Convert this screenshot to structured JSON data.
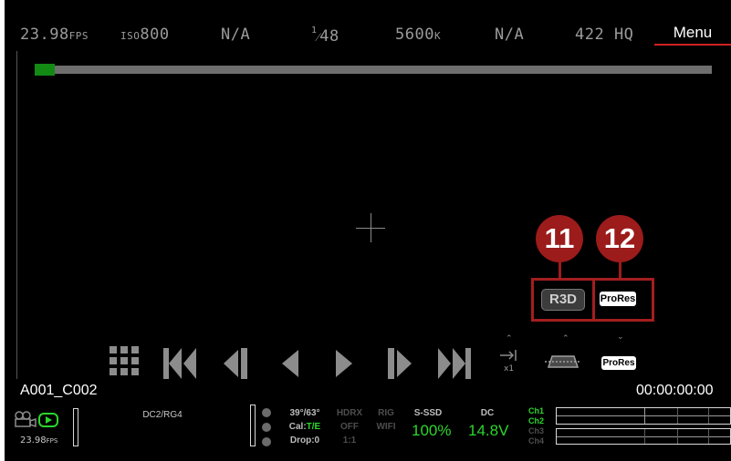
{
  "top_bar": {
    "fps": "23.98",
    "fps_unit": "FPS",
    "iso_prefix": "ISO",
    "iso_value": "800",
    "field3": "N/A",
    "shutter_num": "1",
    "shutter_den": "48",
    "white_balance": "5600",
    "wb_unit": "K",
    "field6": "N/A",
    "codec": "422 HQ",
    "menu_label": "Menu"
  },
  "callouts": [
    {
      "number": "11"
    },
    {
      "number": "12"
    }
  ],
  "format_buttons": {
    "r3d_label": "R3D",
    "prores_label": "ProRes",
    "prores_small_label": "ProRes"
  },
  "playback": {
    "speed_label": "x1"
  },
  "clip": {
    "name": "A001_C002",
    "timecode": "00:00:00:00"
  },
  "bottom_bar": {
    "fps_value": "23.98",
    "fps_unit": "FPS",
    "color_space": "DC2/RG4",
    "temp": "39°/63°",
    "cal_label": "Cal:",
    "cal_value": "T/E",
    "drop_label": "Drop:",
    "drop_value": "0",
    "hdrx_label": "HDRX",
    "hdrx_value": "OFF",
    "hdrx_ratio": "1:1",
    "rig_label": "RIG",
    "wifi_label": "WIFI",
    "media_label": "S-SSD",
    "media_value": "100%",
    "power_label": "DC",
    "power_value": "14.8V",
    "audio_channels": [
      "Ch1",
      "Ch2",
      "Ch3",
      "Ch4"
    ]
  },
  "colors": {
    "accent_red": "#a41e1e",
    "status_green": "#2bd62b",
    "timeline_green": "#138a13"
  },
  "timeline": {
    "position_fraction": 0
  }
}
